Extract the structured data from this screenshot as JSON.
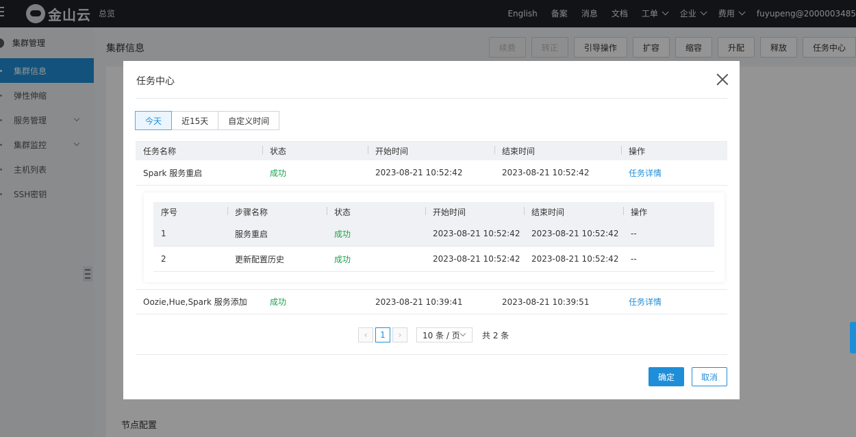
{
  "topbar": {
    "logo_text": "金山云",
    "overview": "总览",
    "items": [
      "English",
      "备案",
      "消息",
      "文档",
      "工单",
      "企业",
      "费用"
    ],
    "user": "fuyupeng@2000003485"
  },
  "sidebar": {
    "header": "集群管理",
    "items": [
      {
        "label": "集群信息"
      },
      {
        "label": "弹性伸缩"
      },
      {
        "label": "服务管理"
      },
      {
        "label": "集群监控"
      },
      {
        "label": "主机列表"
      },
      {
        "label": "SSH密钥"
      }
    ]
  },
  "page": {
    "title": "集群信息",
    "buttons": [
      "续费",
      "转正",
      "引导操作",
      "扩容",
      "缩容",
      "升配",
      "释放",
      "任务中心"
    ],
    "bg_section": "节点配置"
  },
  "modal": {
    "title": "任务中心",
    "tabs": [
      "今天",
      "近15天",
      "自定义时间"
    ],
    "columns": [
      "任务名称",
      "状态",
      "开始时间",
      "结束时间",
      "操作"
    ],
    "rows": [
      {
        "name": "Spark 服务重启",
        "status": "成功",
        "start": "2023-08-21 10:52:42",
        "end": "2023-08-21 10:52:42",
        "action": "任务详情"
      },
      {
        "name": "Oozie,Hue,Spark 服务添加",
        "status": "成功",
        "start": "2023-08-21 10:39:41",
        "end": "2023-08-21 10:39:51",
        "action": "任务详情"
      }
    ],
    "sub_columns": [
      "序号",
      "步骤名称",
      "状态",
      "开始时间",
      "结束时间",
      "操作"
    ],
    "sub_rows": [
      {
        "no": "1",
        "step": "服务重启",
        "status": "成功",
        "start": "2023-08-21 10:52:42",
        "end": "2023-08-21 10:52:42",
        "action": "--"
      },
      {
        "no": "2",
        "step": "更新配置历史",
        "status": "成功",
        "start": "2023-08-21 10:52:42",
        "end": "2023-08-21 10:52:42",
        "action": "--"
      }
    ],
    "pager": {
      "current": "1",
      "page_size": "10 条 / 页",
      "total": "共 2 条"
    },
    "ok_label": "确定",
    "cancel_label": "取消"
  }
}
